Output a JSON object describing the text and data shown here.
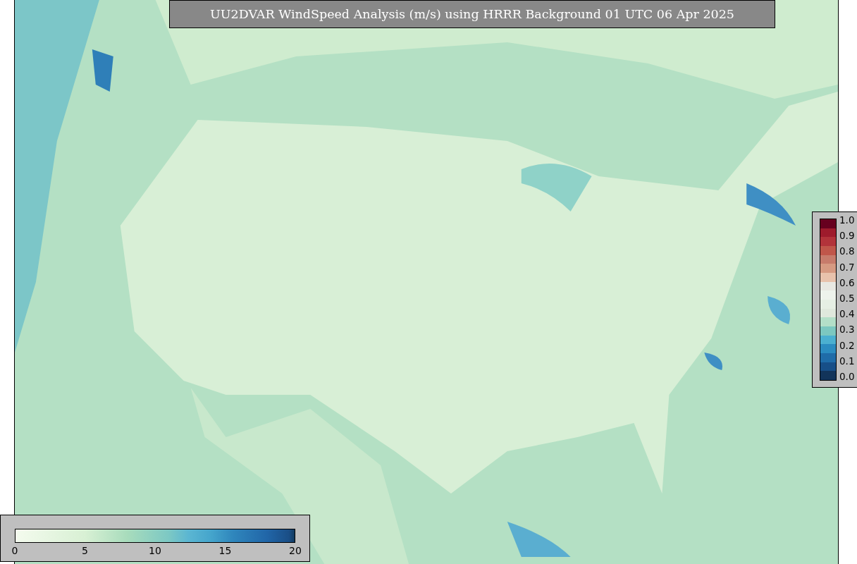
{
  "title": "UU2DVAR WindSpeed Analysis (m/s) using HRRR Background 01 UTC 06 Apr 2025",
  "colorbars": [
    {
      "kind": "vertical",
      "ticks": [
        "1.0",
        "0.9",
        "0.8",
        "0.7",
        "0.6",
        "0.5",
        "0.4",
        "0.3",
        "0.2",
        "0.1",
        "0.0"
      ]
    },
    {
      "kind": "horizontal",
      "ticks": [
        "0",
        "5",
        "10",
        "15",
        "20"
      ]
    }
  ]
}
